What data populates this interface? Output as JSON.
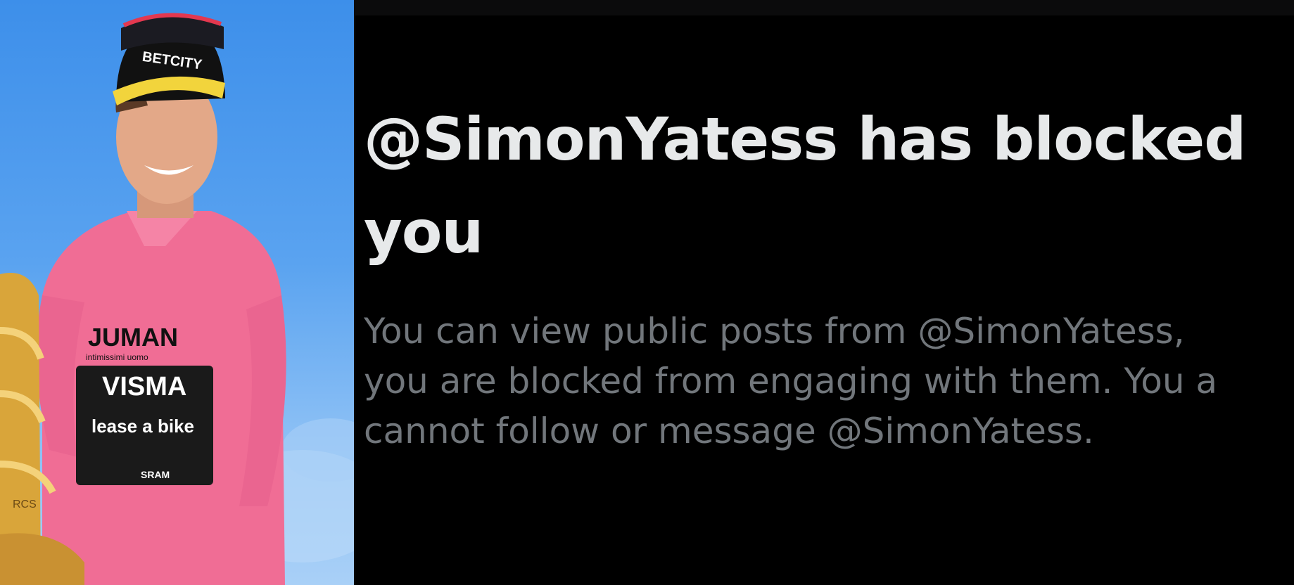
{
  "photo": {
    "cap_brand": "BETCITY",
    "jersey_brand_top": "JUMAN",
    "jersey_brand_small": "intimissimi uomo",
    "jersey_brand_main": "VISMA",
    "jersey_brand_bike": "lease a bike",
    "jersey_brand_bottom": "SRAM",
    "trophy_text": "RCS",
    "colors": {
      "sky": "#4a98ee",
      "jersey": "#f06d95",
      "trophy": "#d9a53a",
      "cap": "#111111",
      "cap_visor": "#f2d43c"
    }
  },
  "block_notice": {
    "title_line1": "@SimonYatess has blocked",
    "title_line2": "you",
    "message_line1": "You can view public posts from @SimonYatess,",
    "message_line2": "you are blocked from engaging with them. You a",
    "message_line3": "cannot follow or message @SimonYatess.",
    "colors": {
      "background": "#000000",
      "title": "#e7e9ea",
      "message": "#71767b"
    }
  }
}
